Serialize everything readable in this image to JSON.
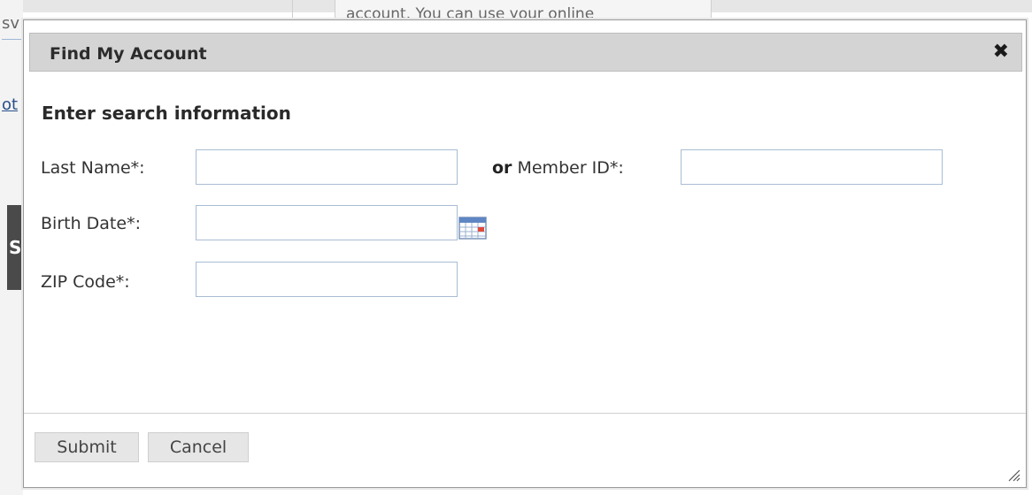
{
  "background": {
    "left_snippet": "sv",
    "left_link": "ot",
    "dark_block": "S",
    "top_box_text": "account. You can use your online"
  },
  "dialog": {
    "title": "Find My Account",
    "close_glyph": "✖",
    "section_heading": "Enter search information",
    "fields": {
      "last_name": {
        "label": "Last Name*:",
        "value": "",
        "placeholder": ""
      },
      "member_id": {
        "or_text": "or",
        "label": " Member ID*:",
        "value": "",
        "placeholder": ""
      },
      "birth_date": {
        "label": "Birth Date*:",
        "value": "",
        "placeholder": ""
      },
      "zip_code": {
        "label": "ZIP Code*:",
        "value": "",
        "placeholder": ""
      }
    },
    "icons": {
      "calendar": "calendar-icon",
      "close": "close-icon",
      "resize": "resize-grip-icon"
    },
    "buttons": {
      "submit": "Submit",
      "cancel": "Cancel"
    }
  },
  "colors": {
    "titlebar_bg": "#d4d4d4",
    "input_border": "#a9bcd4",
    "button_bg": "#e6e6e6"
  }
}
